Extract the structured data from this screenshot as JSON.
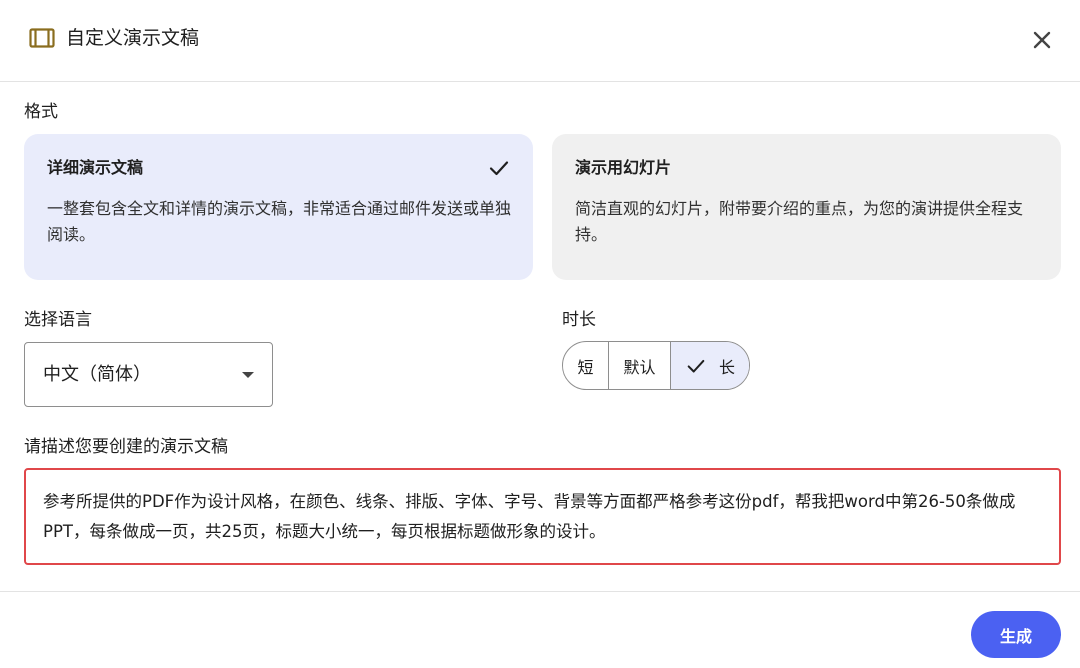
{
  "dialog": {
    "title": "自定义演示文稿"
  },
  "format": {
    "label": "格式",
    "cards": [
      {
        "title": "详细演示文稿",
        "description": "一整套包含全文和详情的演示文稿，非常适合通过邮件发送或单独阅读。",
        "selected": true
      },
      {
        "title": "演示用幻灯片",
        "description": "简洁直观的幻灯片，附带要介绍的重点，为您的演讲提供全程支持。",
        "selected": false
      }
    ]
  },
  "language": {
    "label": "选择语言",
    "value": "中文（简体）"
  },
  "duration": {
    "label": "时长",
    "options": [
      "短",
      "默认",
      "长"
    ],
    "selected": "长"
  },
  "description": {
    "label": "请描述您要创建的演示文稿",
    "value": "参考所提供的PDF作为设计风格，在颜色、线条、排版、字体、字号、背景等方面都严格参考这份pdf，帮我把word中第26-50条做成PPT，每条做成一页，共25页，标题大小统一，每页根据标题做形象的设计。"
  },
  "footer": {
    "generate_label": "生成"
  },
  "colors": {
    "accent": "#4b61f2",
    "selected_bg": "#e9ecfb",
    "highlight_border": "#e0474a"
  },
  "icons": {
    "title": "slides-icon",
    "close": "close-icon",
    "selected": "check-icon",
    "dropdown": "caret-down-icon"
  }
}
